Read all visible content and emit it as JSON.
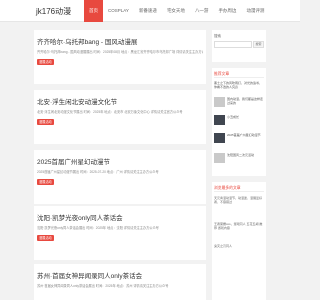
{
  "site": {
    "logo": "jk176动漫"
  },
  "nav": [
    "首页",
    "COSPLAY",
    "新番速递",
    "宅女天地",
    "八一游",
    "手办周边",
    "动漫评测"
  ],
  "posts": [
    {
      "title": "齐齐哈尔·乌托邦bang - 国风动漫展",
      "desc": "齐齐哈尔·乌托邦bang - 国风动漫展展出 时间：2025年08月 地点：黑龙江省齐齐哈尔市乌托邦广场 详情请关注主办方公众号",
      "tag": "漫展活动"
    },
    {
      "title": "北安·浮生闲北安动漫文化节",
      "desc": "北安·浮生闲北安动漫文化节展出 时间：2025年 地点：北安市 北安万象文化中心 详情请关注官方公众号",
      "tag": "漫展活动"
    },
    {
      "title": "2025首届广州星幻动漫节",
      "desc": "2025首届广州星幻动漫节展出 时间：2025-07-20 地点：广州 详情请关注主办方公众号",
      "tag": "漫展活动"
    },
    {
      "title": "沈阳·凯梦光夜only同人茶话会",
      "desc": "沈阳·凯梦光夜only同人茶话会展出 时间：2025年 地点：沈阳 详情请关注主办方公众号",
      "tag": "漫展活动"
    },
    {
      "title": "苏州·首届女神异闻录同人only茶话会",
      "desc": "苏州·首届女神异闻录同人only茶话会展出 时间：2025年 地点：苏州 详情请关注主办方公众号",
      "tag": "漫展活动"
    }
  ],
  "search": {
    "label": "搜索",
    "placeholder": "",
    "button": "搜索"
  },
  "recommend": {
    "heading": "推荐文章",
    "items": [
      {
        "text": "黑土之下的风吹雨打，对光的追寻，你看不透的人究竟",
        "date": "2025-07"
      },
      {
        "text": "国内动漫，我们都是这样走过来的",
        "date": "2025-07"
      },
      {
        "text": "小丑成长",
        "date": "2025-07"
      },
      {
        "text": "2025首届广州星幻动漫节",
        "date": "2025-07"
      },
      {
        "text": "沈阳国风二次元活动",
        "date": "2025-07"
      }
    ]
  },
  "browse": {
    "heading": "浏览最多的文章",
    "lines": [
      "天元青漫动漫节，动漫迷、漫展爱好者、不容错过",
      "",
      "王者荣耀cos，游戏同人 五花五胡 推荐 游戏内容",
      "",
      "鬼灭之刃同人"
    ]
  }
}
